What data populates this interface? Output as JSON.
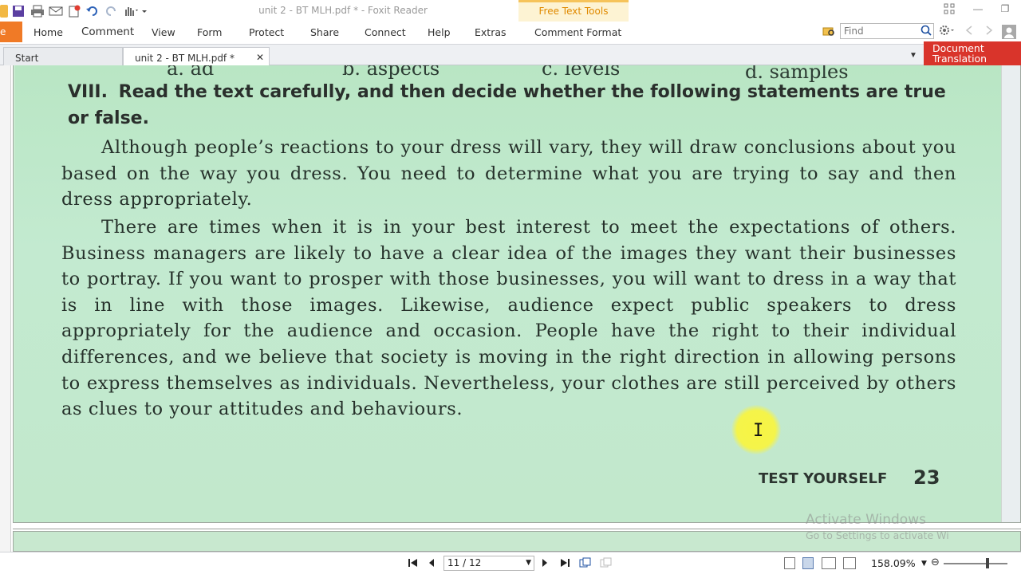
{
  "app": {
    "window_title": "unit 2 - BT MLH.pdf * - Foxit Reader",
    "context_tab": "Free Text Tools",
    "window_buttons": [
      "—",
      "❐",
      "✕"
    ]
  },
  "ribbon": {
    "file_tab": "e",
    "tabs": [
      "Home",
      "Comment",
      "View",
      "Form",
      "Protect",
      "Share",
      "Connect",
      "Help",
      "Extras",
      "Comment Format"
    ],
    "find_placeholder": "Find"
  },
  "document_tabs": {
    "start": "Start",
    "active": "unit 2 - BT MLH.pdf *",
    "translate_button": [
      "Document",
      "Translation"
    ]
  },
  "page": {
    "prev_options": [
      "a. ad",
      "b. aspects",
      "c. levels",
      "d. samples"
    ],
    "heading_number": "VIII.",
    "heading_text": "Read the text carefully, and then decide whether the following statements are true or false.",
    "paragraph1": "Although people’s reactions to your dress will vary, they will draw conclusions about you based on the way you dress. You need to determine what you are trying to say and then dress appropriately.",
    "paragraph2": "There are times when it is in your best interest to meet the expectations of others. Business managers are likely to have a clear idea of the images they want their businesses to portray. If you want to prosper with those businesses, you will want to dress in a way that is in line with those images. Likewise, audience expect public speakers to dress appropriately for the audience and occasion. People have the right to their individual differences, and we believe that society is moving in the right direction in allowing persons to express themselves as individuals. Nevertheless, your clothes are still perceived by others as clues to your attitudes and behaviours.",
    "footer_label": "TEST YOURSELF",
    "footer_page_number": "23"
  },
  "watermark": {
    "line1": "Activate Windows",
    "line2": "Go to Settings to activate Wi"
  },
  "statusbar": {
    "page_indicator": "11 / 12",
    "zoom": "158.09%"
  },
  "colors": {
    "page_green": "#c3ead0",
    "ribbon_accent": "#f07a26",
    "translate_red": "#d9342b",
    "cursor_highlight": "#faf53c"
  }
}
